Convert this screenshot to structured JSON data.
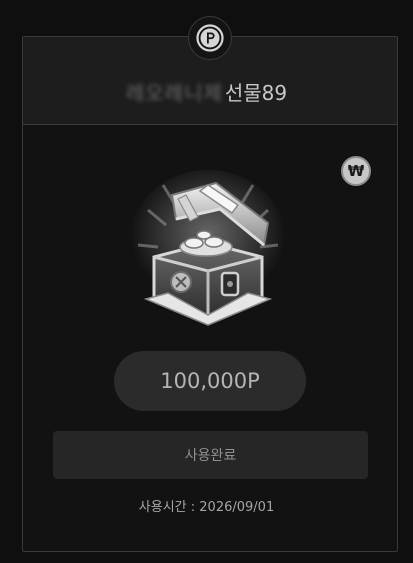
{
  "header": {
    "blurred_name": "레오레니제",
    "title": "선물89",
    "badge_icon": "p-coin-icon"
  },
  "badge": {
    "currency_symbol": "₩"
  },
  "gift": {
    "image": "treasure-chest-icon"
  },
  "amount": {
    "text": "100,000P"
  },
  "action": {
    "used_label": "사용완료"
  },
  "usage": {
    "label": "사용시간",
    "separator": " : ",
    "date": "2026/09/01"
  },
  "colors": {
    "background": "#0f0f0f",
    "card": "#121212",
    "header": "#1d1d1d",
    "pill": "#2b2b2b",
    "button": "#262626"
  }
}
